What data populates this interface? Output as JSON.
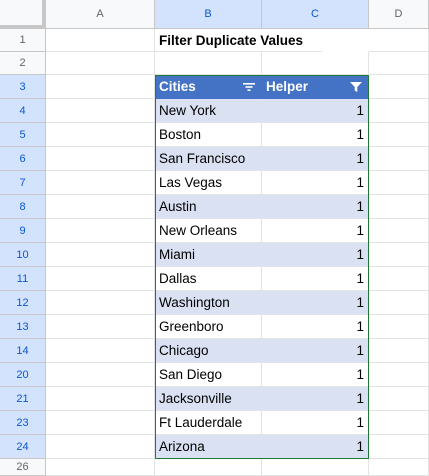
{
  "columns": [
    "A",
    "B",
    "C",
    "D"
  ],
  "row_numbers": [
    "1",
    "2",
    "3",
    "4",
    "5",
    "6",
    "7",
    "8",
    "9",
    "10",
    "11",
    "12",
    "13",
    "14",
    "20",
    "21",
    "23",
    "24",
    "26"
  ],
  "title": "Filter Duplicate Values",
  "table": {
    "headers": [
      "Cities",
      "Helper"
    ],
    "rows": [
      {
        "city": "New York",
        "helper": "1"
      },
      {
        "city": "Boston",
        "helper": "1"
      },
      {
        "city": "San Francisco",
        "helper": "1"
      },
      {
        "city": "Las Vegas",
        "helper": "1"
      },
      {
        "city": "Austin",
        "helper": "1"
      },
      {
        "city": "New Orleans",
        "helper": "1"
      },
      {
        "city": "Miami",
        "helper": "1"
      },
      {
        "city": "Dallas",
        "helper": "1"
      },
      {
        "city": "Washington",
        "helper": "1"
      },
      {
        "city": "Greenboro",
        "helper": "1"
      },
      {
        "city": "Chicago",
        "helper": "1"
      },
      {
        "city": "San Diego",
        "helper": "1"
      },
      {
        "city": "Jacksonville",
        "helper": "1"
      },
      {
        "city": "Ft Lauderdale",
        "helper": "1"
      },
      {
        "city": "Arizona",
        "helper": "1"
      }
    ]
  },
  "icons": {
    "cities_filter": "filter-lines-icon",
    "helper_filter": "filter-funnel-icon"
  },
  "colors": {
    "header_fill": "#4472c4",
    "band_fill": "#d9e1f2",
    "table_border": "#1e7b34"
  }
}
